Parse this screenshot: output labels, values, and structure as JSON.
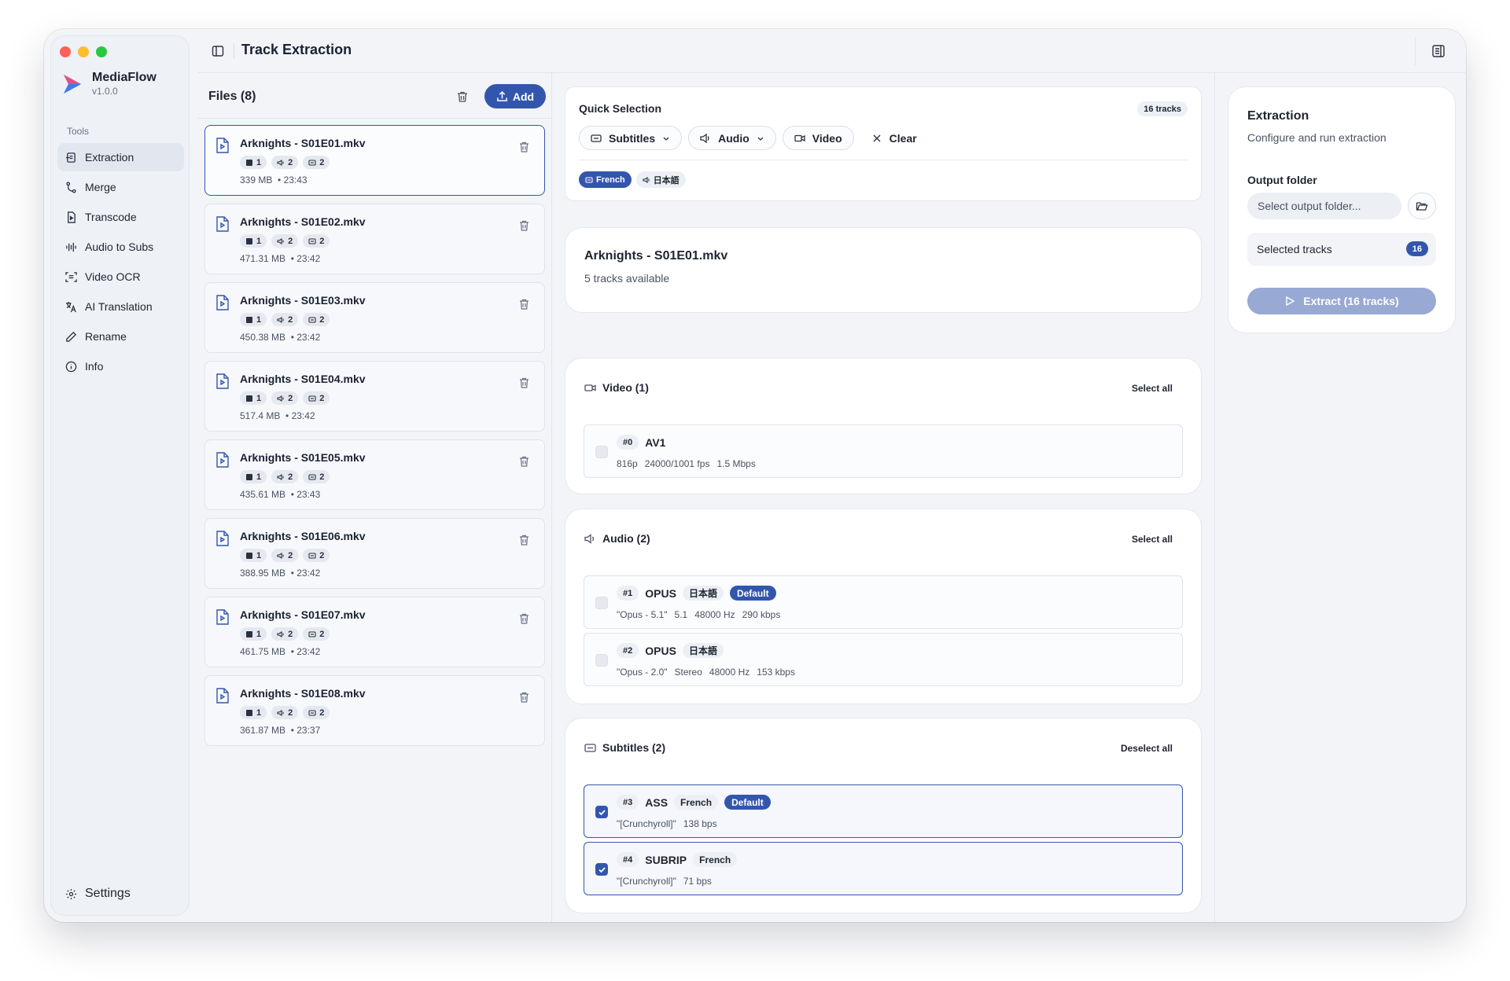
{
  "app": {
    "name": "MediaFlow",
    "version": "v1.0.0"
  },
  "sidebar": {
    "section_label": "Tools",
    "items": [
      {
        "label": "Extraction",
        "icon": "extraction-icon",
        "active": true
      },
      {
        "label": "Merge",
        "icon": "merge-icon"
      },
      {
        "label": "Transcode",
        "icon": "transcode-icon"
      },
      {
        "label": "Audio to Subs",
        "icon": "waveform-icon"
      },
      {
        "label": "Video OCR",
        "icon": "scan-icon"
      },
      {
        "label": "AI Translation",
        "icon": "translate-icon"
      },
      {
        "label": "Rename",
        "icon": "pencil-icon"
      },
      {
        "label": "Info",
        "icon": "info-icon"
      }
    ],
    "settings_label": "Settings"
  },
  "header": {
    "title": "Track Extraction"
  },
  "files": {
    "title": "Files (8)",
    "add_label": "Add",
    "items": [
      {
        "name": "Arknights - S01E01.mkv",
        "video": "1",
        "audio": "2",
        "subs": "2",
        "size": "339 MB",
        "duration": "• 23:43"
      },
      {
        "name": "Arknights - S01E02.mkv",
        "video": "1",
        "audio": "2",
        "subs": "2",
        "size": "471.31 MB",
        "duration": "• 23:42"
      },
      {
        "name": "Arknights - S01E03.mkv",
        "video": "1",
        "audio": "2",
        "subs": "2",
        "size": "450.38 MB",
        "duration": "• 23:42"
      },
      {
        "name": "Arknights - S01E04.mkv",
        "video": "1",
        "audio": "2",
        "subs": "2",
        "size": "517.4 MB",
        "duration": "• 23:42"
      },
      {
        "name": "Arknights - S01E05.mkv",
        "video": "1",
        "audio": "2",
        "subs": "2",
        "size": "435.61 MB",
        "duration": "• 23:43"
      },
      {
        "name": "Arknights - S01E06.mkv",
        "video": "1",
        "audio": "2",
        "subs": "2",
        "size": "388.95 MB",
        "duration": "• 23:42"
      },
      {
        "name": "Arknights - S01E07.mkv",
        "video": "1",
        "audio": "2",
        "subs": "2",
        "size": "461.75 MB",
        "duration": "• 23:42"
      },
      {
        "name": "Arknights - S01E08.mkv",
        "video": "1",
        "audio": "2",
        "subs": "2",
        "size": "361.87 MB",
        "duration": "• 23:37"
      }
    ]
  },
  "quick_selection": {
    "title": "Quick Selection",
    "count": "16 tracks",
    "buttons": {
      "subtitles": "Subtitles",
      "audio": "Audio",
      "video": "Video",
      "clear": "Clear"
    },
    "tags": [
      {
        "label": "French",
        "selected": true
      },
      {
        "label": "日本語",
        "selected": false
      }
    ]
  },
  "file_info": {
    "name": "Arknights - S01E01.mkv",
    "subtitle": "5 tracks available"
  },
  "video_section": {
    "title": "Video (1)",
    "action": "Select all",
    "tracks": [
      {
        "index": "#0",
        "codec": "AV1",
        "details": [
          "816p",
          "24000/1001 fps",
          "1.5 Mbps"
        ]
      }
    ]
  },
  "audio_section": {
    "title": "Audio (2)",
    "action": "Select all",
    "tracks": [
      {
        "index": "#1",
        "codec": "OPUS",
        "lang": "日本語",
        "default": "Default",
        "details": [
          "\"Opus - 5.1\"",
          "5.1",
          "48000 Hz",
          "290 kbps"
        ]
      },
      {
        "index": "#2",
        "codec": "OPUS",
        "lang": "日本語",
        "details": [
          "\"Opus - 2.0\"",
          "Stereo",
          "48000 Hz",
          "153 kbps"
        ]
      }
    ]
  },
  "subtitle_section": {
    "title": "Subtitles (2)",
    "action": "Deselect all",
    "tracks": [
      {
        "index": "#3",
        "codec": "ASS",
        "lang": "French",
        "default": "Default",
        "details": [
          "\"[Crunchyroll]\"",
          "138 bps"
        ]
      },
      {
        "index": "#4",
        "codec": "SUBRIP",
        "lang": "French",
        "details": [
          "\"[Crunchyroll]\"",
          "71 bps"
        ]
      }
    ]
  },
  "extraction": {
    "title": "Extraction",
    "subtitle": "Configure and run extraction",
    "output_label": "Output folder",
    "output_placeholder": "Select output folder...",
    "selected_label": "Selected tracks",
    "selected_count": "16",
    "run_label": "Extract (16 tracks)"
  },
  "colors": {
    "accent": "#3356ad",
    "accent_disabled": "#98a9d3"
  }
}
